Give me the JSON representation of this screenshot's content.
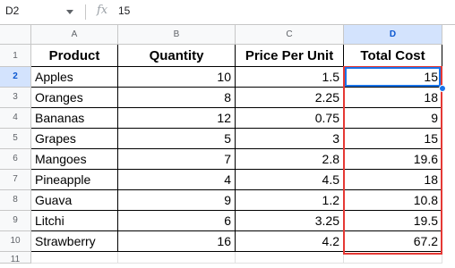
{
  "formula_bar": {
    "name_box": "D2",
    "fx_icon": "function-icon",
    "formula_value": "15"
  },
  "columns": [
    "A",
    "B",
    "C",
    "D"
  ],
  "row_numbers": [
    "1",
    "2",
    "3",
    "4",
    "5",
    "6",
    "7",
    "8",
    "9",
    "10",
    "11"
  ],
  "sheet": {
    "headers": [
      "Product",
      "Quantity",
      "Price Per Unit",
      "Total Cost"
    ],
    "rows": [
      {
        "product": "Apples",
        "quantity": "10",
        "price": "1.5",
        "total": "15"
      },
      {
        "product": "Oranges",
        "quantity": "8",
        "price": "2.25",
        "total": "18"
      },
      {
        "product": "Bananas",
        "quantity": "12",
        "price": "0.75",
        "total": "9"
      },
      {
        "product": "Grapes",
        "quantity": "5",
        "price": "3",
        "total": "15"
      },
      {
        "product": "Mangoes",
        "quantity": "7",
        "price": "2.8",
        "total": "19.6"
      },
      {
        "product": "Pineapple",
        "quantity": "4",
        "price": "4.5",
        "total": "18"
      },
      {
        "product": "Guava",
        "quantity": "9",
        "price": "1.2",
        "total": "10.8"
      },
      {
        "product": "Litchi",
        "quantity": "6",
        "price": "3.25",
        "total": "19.5"
      },
      {
        "product": "Strawberry",
        "quantity": "16",
        "price": "4.2",
        "total": "67.2"
      }
    ]
  },
  "colors": {
    "highlight_box": "#e53935",
    "selection": "#1a73e8",
    "selected_header_bg": "#d3e3fd"
  }
}
